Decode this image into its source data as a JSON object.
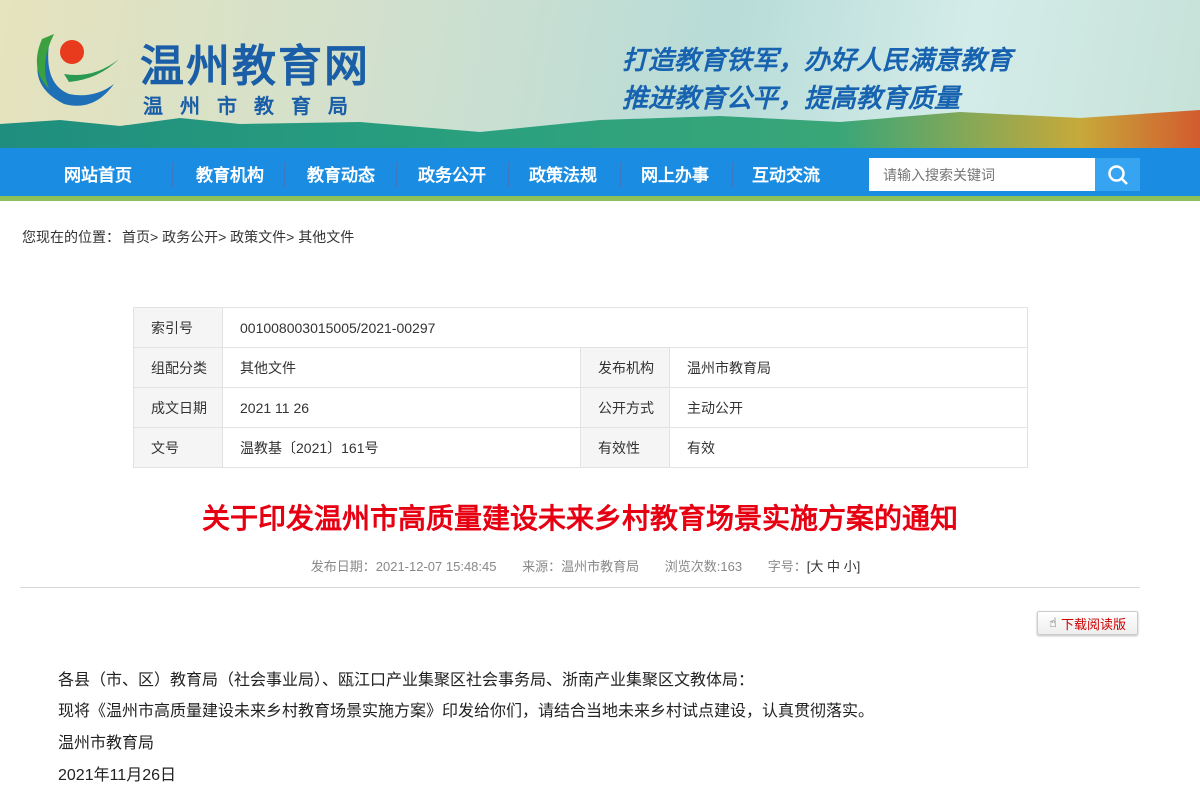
{
  "header": {
    "site_title": "温州教育网",
    "site_subtitle": "温州市教育局",
    "slogans": [
      "打造教育铁军，办好人民满意教育",
      "推进教育公平，提高教育质量"
    ]
  },
  "nav": {
    "items": [
      "网站首页",
      "教育机构",
      "教育动态",
      "政务公开",
      "政策法规",
      "网上办事",
      "互动交流"
    ],
    "search_placeholder": "请输入搜索关键词"
  },
  "breadcrumb": {
    "prefix": "您现在的位置：",
    "items": [
      "首页>",
      "政务公开>",
      "政策文件>",
      "其他文件"
    ]
  },
  "info": {
    "index_label": "索引号",
    "index_value": "001008003015005/2021-00297",
    "category_label": "组配分类",
    "category_value": "其他文件",
    "publisher_label": "发布机构",
    "publisher_value": "温州市教育局",
    "date_label": "成文日期",
    "date_value": "2021 11 26",
    "public_label": "公开方式",
    "public_value": "主动公开",
    "docno_label": "文号",
    "docno_value": "温教基〔2021〕161号",
    "valid_label": "有效性",
    "valid_value": "有效"
  },
  "article": {
    "title": "关于印发温州市高质量建设未来乡村教育场景实施方案的通知",
    "publish_date": "发布日期：2021-12-07 15:48:45",
    "source": "来源：温州市教育局",
    "views": "浏览次数:163",
    "fontsize_label": "字号：",
    "font_sizes": [
      "[大",
      "中",
      "小]"
    ],
    "download_label": "下载阅读版",
    "paragraphs": [
      "各县（市、区）教育局（社会事业局）、瓯江口产业集聚区社会事务局、浙南产业集聚区文教体局：",
      "现将《温州市高质量建设未来乡村教育场景实施方案》印发给你们，请结合当地未来乡村试点建设，认真贯彻落实。",
      "温州市教育局",
      "2021年11月26日"
    ]
  }
}
